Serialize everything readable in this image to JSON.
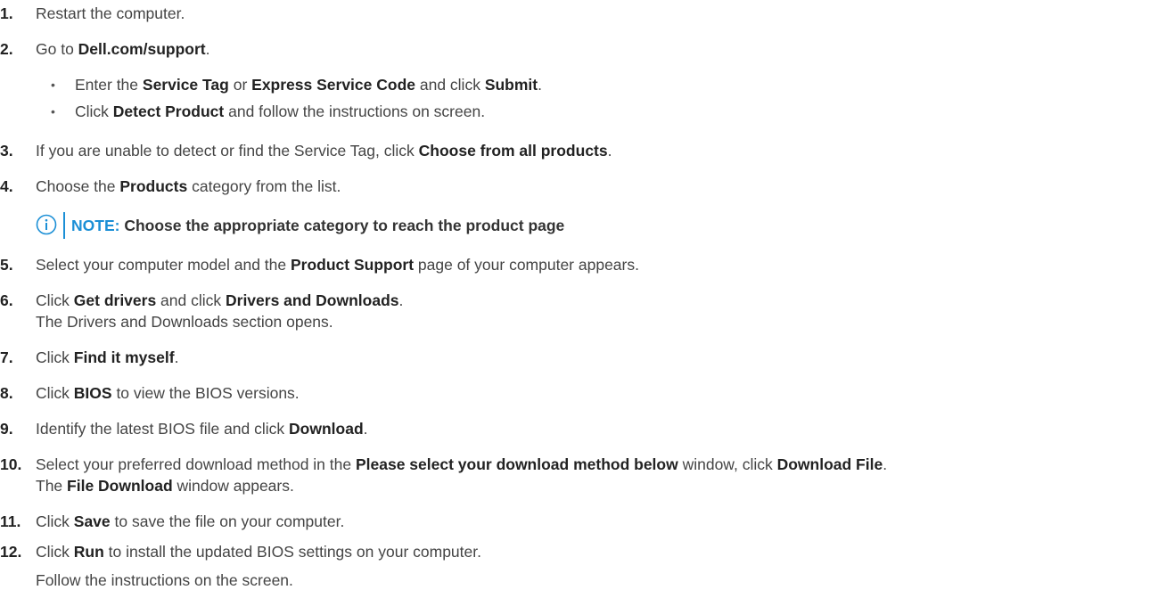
{
  "steps": [
    {
      "num": "1.",
      "parts": [
        {
          "t": "Restart the computer."
        }
      ]
    },
    {
      "num": "2.",
      "parts": [
        {
          "t": "Go to "
        },
        {
          "t": "Dell.com/support",
          "b": true
        },
        {
          "t": "."
        }
      ]
    },
    {
      "num": "3.",
      "parts": [
        {
          "t": "If you are unable to detect or find the Service Tag, click "
        },
        {
          "t": "Choose from all products",
          "b": true
        },
        {
          "t": "."
        }
      ]
    },
    {
      "num": "4.",
      "parts": [
        {
          "t": "Choose the "
        },
        {
          "t": "Products",
          "b": true
        },
        {
          "t": " category from the list."
        }
      ]
    },
    {
      "num": "5.",
      "parts": [
        {
          "t": "Select your computer model and the "
        },
        {
          "t": "Product Support",
          "b": true
        },
        {
          "t": " page of your computer appears."
        }
      ]
    },
    {
      "num": "6.",
      "parts": [
        {
          "t": "Click "
        },
        {
          "t": "Get drivers",
          "b": true
        },
        {
          "t": " and click "
        },
        {
          "t": "Drivers and Downloads",
          "b": true
        },
        {
          "t": "."
        }
      ]
    },
    {
      "num": "7.",
      "parts": [
        {
          "t": "Click "
        },
        {
          "t": "Find it myself",
          "b": true
        },
        {
          "t": "."
        }
      ]
    },
    {
      "num": "8.",
      "parts": [
        {
          "t": "Click "
        },
        {
          "t": "BIOS",
          "b": true
        },
        {
          "t": " to view the BIOS versions."
        }
      ]
    },
    {
      "num": "9.",
      "parts": [
        {
          "t": "Identify the latest BIOS file and click "
        },
        {
          "t": "Download",
          "b": true
        },
        {
          "t": "."
        }
      ]
    },
    {
      "num": "10.",
      "parts": [
        {
          "t": "Select your preferred download method in the "
        },
        {
          "t": "Please select your download method below",
          "b": true
        },
        {
          "t": " window, click "
        },
        {
          "t": "Download File",
          "b": true
        },
        {
          "t": "."
        }
      ]
    },
    {
      "num": "11.",
      "parts": [
        {
          "t": "Click "
        },
        {
          "t": "Save",
          "b": true
        },
        {
          "t": " to save the file on your computer."
        }
      ]
    },
    {
      "num": "12.",
      "parts": [
        {
          "t": "Click "
        },
        {
          "t": "Run",
          "b": true
        },
        {
          "t": " to install the updated BIOS settings on your computer."
        }
      ]
    }
  ],
  "bullets": [
    {
      "parts": [
        {
          "t": "Enter the "
        },
        {
          "t": "Service Tag",
          "b": true
        },
        {
          "t": " or "
        },
        {
          "t": "Express Service Code",
          "b": true
        },
        {
          "t": " and click "
        },
        {
          "t": "Submit",
          "b": true
        },
        {
          "t": "."
        }
      ]
    },
    {
      "parts": [
        {
          "t": "Click "
        },
        {
          "t": "Detect Product",
          "b": true
        },
        {
          "t": " and follow the instructions on screen."
        }
      ]
    }
  ],
  "bullet_glyph": "•",
  "note": {
    "label": "NOTE:",
    "text": " Choose the appropriate category to reach the product page",
    "icon": "info-icon",
    "accent_color": "#1b8fd6"
  },
  "step6_sub": "The Drivers and Downloads section opens.",
  "step10_sub": [
    {
      "t": "The "
    },
    {
      "t": "File Download",
      "b": true
    },
    {
      "t": " window appears."
    }
  ],
  "step12_sub": "Follow the instructions on the screen."
}
